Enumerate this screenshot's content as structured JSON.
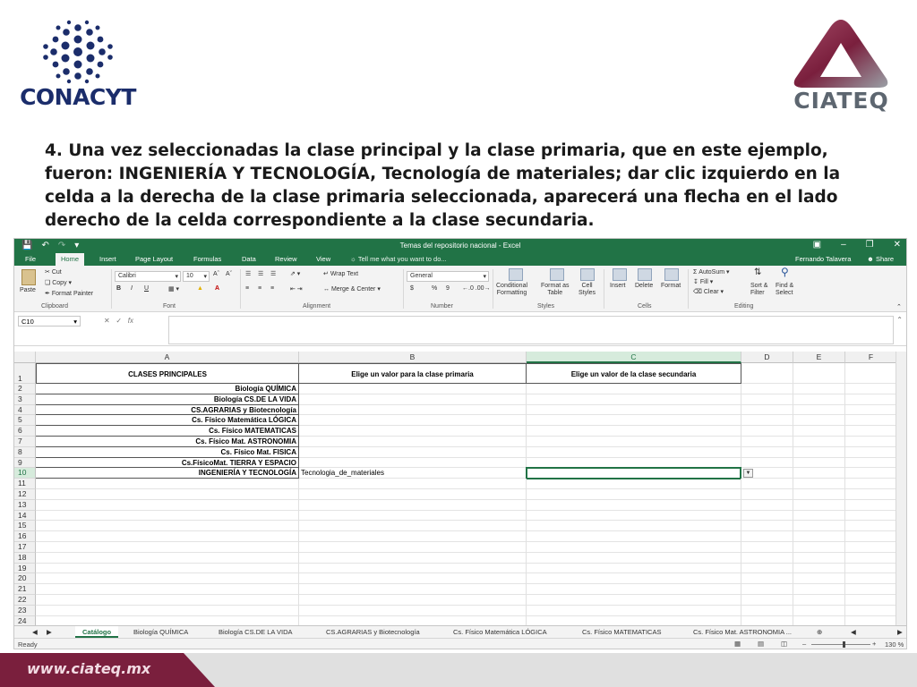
{
  "logos": {
    "left_text": "CONACYT",
    "right_text": "CIATEQ",
    "left_color": "#1b2d6b",
    "right_color": "#8a2e4a"
  },
  "instructions": [
    "4. Una vez seleccionadas la clase principal y la clase primaria, que en este ejemplo,",
    "fueron: INGENIERÍA Y TECNOLOGÍA, Tecnología de materiales; dar clic izquierdo en la",
    "celda a la derecha de la clase primaria seleccionada, aparecerá una flecha en el lado",
    "derecho de la celda correspondiente a la clase secundaria."
  ],
  "excel": {
    "quick_access": [
      "save-icon",
      "undo-icon",
      "redo-icon"
    ],
    "title": "Temas del repositorio nacional - Excel",
    "window_controls": [
      "ribbon-display-icon",
      "minimize-icon",
      "restore-icon",
      "close-icon"
    ],
    "tabs": [
      "File",
      "Home",
      "Insert",
      "Page Layout",
      "Formulas",
      "Data",
      "Review",
      "View"
    ],
    "active_tab": "Home",
    "tell_me": "Tell me what you want to do...",
    "user": "Fernando Talavera",
    "share": "Share",
    "ribbon": {
      "paste": "Paste",
      "cut": "Cut",
      "copy": "Copy",
      "format_painter": "Format Painter",
      "font_name": "Calibri",
      "font_size": "10",
      "bold": "B",
      "italic": "I",
      "underline": "U",
      "wrap_text": "Wrap Text",
      "merge_center": "Merge & Center",
      "number_format": "General",
      "currency": "$",
      "percent": "%",
      "comma": "9",
      "conditional": "Conditional\nFormatting",
      "format_table": "Format as\nTable",
      "cell_styles": "Cell\nStyles",
      "insert": "Insert",
      "delete": "Delete",
      "format": "Format",
      "autosum": "AutoSum",
      "fill": "Fill",
      "clear": "Clear",
      "sort_filter": "Sort &\nFilter",
      "find_select": "Find &\nSelect",
      "groups": [
        "Clipboard",
        "Font",
        "Alignment",
        "Number",
        "Styles",
        "Cells",
        "Editing"
      ]
    },
    "name_box": "C10",
    "fx": "fx",
    "columns": [
      "A",
      "B",
      "C",
      "D",
      "E",
      "F"
    ],
    "selected_column": "C",
    "row_numbers": [
      "1",
      "2",
      "3",
      "4",
      "5",
      "6",
      "7",
      "8",
      "9",
      "10",
      "11",
      "12",
      "13",
      "14",
      "15",
      "16",
      "17",
      "18",
      "19",
      "20",
      "21",
      "22",
      "23",
      "24"
    ],
    "selected_row": "10",
    "headers": {
      "A": "CLASES PRINCIPALES",
      "B": "Elige un valor para la clase primaria",
      "C": "Elige un valor de la clase secundaria"
    },
    "classes": [
      "Biología QUÍMICA",
      "Biología CS.DE LA VIDA",
      "CS.AGRARIAS y Biotecnología",
      "Cs. Físico Matemática LÓGICA",
      "Cs. Físico MATEMATICAS",
      "Cs. Físico Mat. ASTRONOMIA",
      "Cs. Físico Mat. FISICA",
      "Cs.FísicoMat. TIERRA Y ESPACIO",
      "INGENIERÍA Y TECNOLOGÍA"
    ],
    "b10_value": "Tecnologia_de_materiales",
    "sheet_tabs": [
      "Catálogo",
      "Biología QUÍMICA",
      "Biología CS.DE LA VIDA",
      "CS.AGRARIAS y Biotecnología",
      "Cs. Físico Matemática LÓGICA",
      "Cs. Físico MATEMATICAS",
      "Cs. Físico Mat. ASTRONOMIA ..."
    ],
    "active_sheet": "Catálogo",
    "status": "Ready",
    "zoom": "130 %",
    "accent": "#217346"
  },
  "footer": {
    "url": "www.ciateq.mx",
    "color": "#7a1f3d"
  }
}
